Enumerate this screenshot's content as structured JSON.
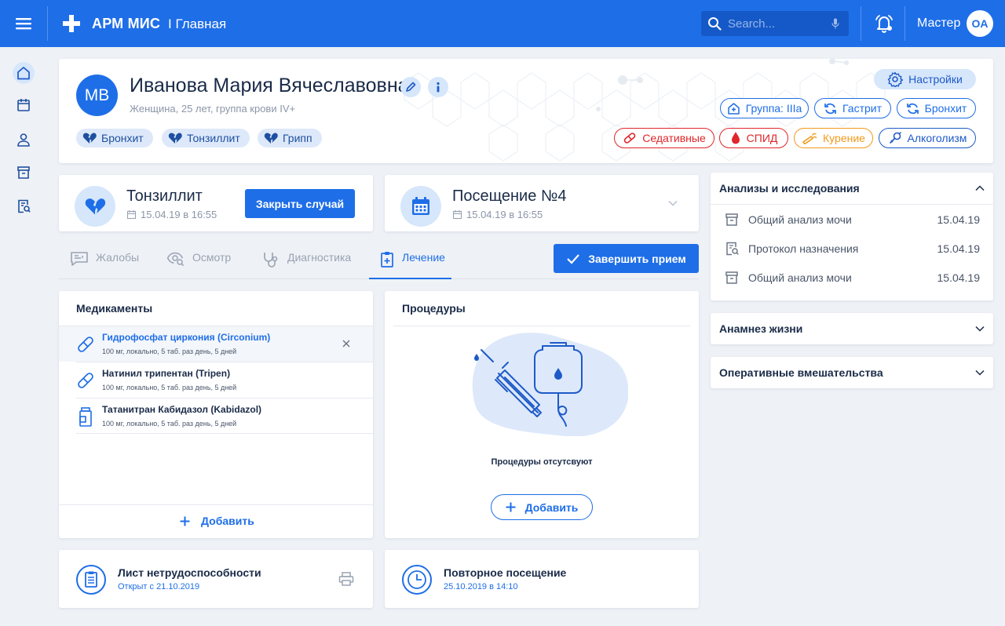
{
  "header": {
    "app_title": "АРМ МИС",
    "breadcrumb": "I Главная",
    "search_placeholder": "Search...",
    "user_name": "Мастер",
    "user_initials": "OA"
  },
  "sidebar": {
    "items": [
      {
        "icon": "home-icon",
        "active": true
      },
      {
        "icon": "calendar-icon",
        "active": false
      },
      {
        "icon": "user-icon",
        "active": false
      },
      {
        "icon": "archive-icon",
        "active": false
      },
      {
        "icon": "document-search-icon",
        "active": false
      }
    ]
  },
  "patient": {
    "initials": "MB",
    "name": "Иванова Мария Вячеславовна",
    "info": "Женщина, 25 лет, группа крови IV+",
    "diagnoses": [
      "Бронхит",
      "Тонзиллит",
      "Грипп"
    ],
    "settings_label": "Настройки",
    "groups": [
      "Группа: IIIa",
      "Гастрит",
      "Бронхит"
    ],
    "risks": [
      "Седативные",
      "СПИД",
      "Курение",
      "Алкоголизм"
    ]
  },
  "case": {
    "title": "Тонзиллит",
    "date": "15.04.19 в 16:55",
    "close_label": "Закрыть случай"
  },
  "visit": {
    "title": "Посещение №4",
    "date": "15.04.19 в 16:55"
  },
  "tabs": [
    {
      "label": "Жалобы",
      "active": false
    },
    {
      "label": "Осмотр",
      "active": false
    },
    {
      "label": "Диагностика",
      "active": false
    },
    {
      "label": "Лечение",
      "active": true
    }
  ],
  "finish_label": "Завершить прием",
  "medications": {
    "title": "Медикаменты",
    "items": [
      {
        "name": "Гидрофосфат циркония (Circonium)",
        "desc": "100 мг, локально, 5 таб. раз день, 5 дней",
        "icon": "pill-icon"
      },
      {
        "name": "Натинил трипентан (Tripen)",
        "desc": "100 мг, локально, 5 таб. раз день, 5 дней",
        "icon": "pill-icon"
      },
      {
        "name": "Татанитран Кабидазол (Kabidazol)",
        "desc": "100 мг, локально, 5 таб. раз день, 5 дней",
        "icon": "bottle-icon"
      }
    ],
    "add_label": "Добавить"
  },
  "procedures": {
    "title": "Процедуры",
    "empty_text": "Процедуры отсутсвуют",
    "add_label": "Добавить"
  },
  "analyses": {
    "title": "Анализы и исследования",
    "items": [
      {
        "name": "Общий анализ мочи",
        "date": "15.04.19",
        "icon": "archive-icon"
      },
      {
        "name": "Протокол назначения",
        "date": "15.04.19",
        "icon": "document-search-icon"
      },
      {
        "name": "Общий анализ мочи",
        "date": "15.04.19",
        "icon": "archive-icon"
      }
    ]
  },
  "anamnesis_title": "Анамнез жизни",
  "surgery_title": "Оперативные вмешательства",
  "sick_leave": {
    "title": "Лист нетрудоспособности",
    "subtitle": "Открыт с 21.10.2019"
  },
  "revisit": {
    "title": "Повторное посещение",
    "subtitle": "25.10.2019 в 14:10"
  },
  "colors": {
    "primary": "#1e6ee8",
    "red": "#e0262a",
    "orange": "#f29a1c",
    "background": "#eef1f6"
  }
}
